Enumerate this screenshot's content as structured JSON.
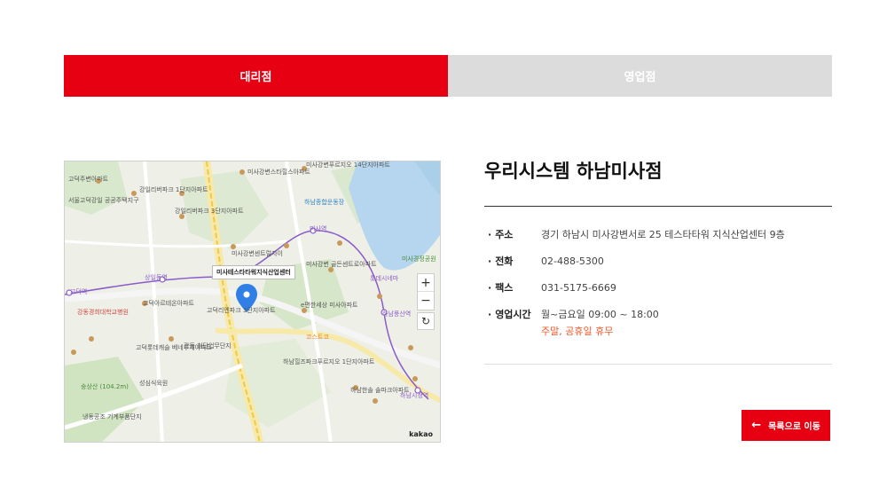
{
  "tabs": [
    {
      "label": "대리점",
      "active": true
    },
    {
      "label": "영업점",
      "active": false
    }
  ],
  "store": {
    "name": "우리시스템 하남미사점",
    "fields": [
      {
        "key": "주소",
        "value": "경기 하남시 미사강변서로 25 테스타타워 지식산업센터 9층"
      },
      {
        "key": "전화",
        "value": "02-488-5300"
      },
      {
        "key": "팩스",
        "value": "031-5175-6669"
      },
      {
        "key": "영업시간",
        "value": "월~금요일 09:00 ~ 18:00",
        "note": "주말, 공휴일 휴무"
      }
    ]
  },
  "map": {
    "marker_label": "미사테스타타워지식산업센터",
    "zoom_in": "+",
    "zoom_out": "−",
    "refresh": "↻",
    "provider": "kakao",
    "labels": {
      "l1": "고덕주변아파트",
      "l2": "서울고덕강일 공공주택지구",
      "l3": "강일리버파크 1단지아파트",
      "l4": "강일리버파크 3단지아파트",
      "l5": "미사강변스타힐스아파트",
      "l6": "미사강변푸르지오 14단지아파트",
      "l7": "미사역",
      "l8": "미사강변센트럴자이",
      "l9": "하남종합운동장",
      "l10": "고덕롯데캐슬 베네루체아파트",
      "l11": "상일동역",
      "l12": "코스트코",
      "l13": "하남힐즈파크푸르지오 1단지아파트",
      "l14": "하남시청역",
      "l15": "숭상산 (104.2m)",
      "l16": "냉동공조 기계부품단지",
      "l17": "미사경정공원",
      "l18": "롯데시네마",
      "l19": "하남풍산역",
      "l20": "강동경희대학교병원",
      "l21": "고덕역",
      "l22": "강동 첨단업무단지",
      "l23": "고덕아르테온아파트",
      "l24": "미사강변 골든센트로아파트",
      "l25": "e편한세상 미사아파트",
      "l26": "하남한솔 솔파크아파트",
      "l27": "성심식육원",
      "l28": "고덕리엔파크 3단지아파트"
    }
  },
  "back_button": {
    "label": "목록으로 이동",
    "icon": "arrow-left-icon"
  },
  "colors": {
    "accent": "#e60012",
    "holiday": "#e8582b",
    "inactive_tab": "#dcdcdc"
  }
}
